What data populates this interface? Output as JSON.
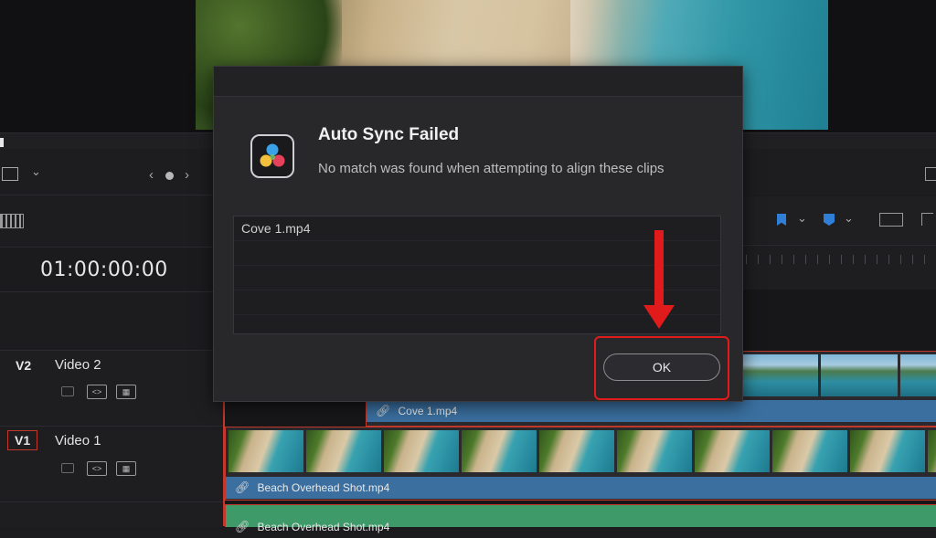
{
  "viewer": {
    "image": "beach-aerial-frame"
  },
  "left_panel": {
    "timecode": "01:00:00:00",
    "tracks": [
      {
        "id": "V2",
        "name": "Video 2"
      },
      {
        "id": "V1",
        "name": "Video 1"
      }
    ]
  },
  "timeline": {
    "clips": [
      {
        "track": "V2",
        "name": "Cove 1.mp4"
      },
      {
        "track": "V1",
        "name": "Beach Overhead Shot.mp4"
      },
      {
        "track": "A1",
        "name": "Beach Overhead Shot.mp4"
      }
    ]
  },
  "dialog": {
    "title": "Auto Sync Failed",
    "message": "No match was found when attempting to align these clips",
    "list_items": [
      "Cove 1.mp4"
    ],
    "ok_label": "OK"
  },
  "annotation": {
    "color": "#e11b1b"
  },
  "colors": {
    "playhead": "#c8362c",
    "video_clip_bar": "#3a6f9f",
    "audio_clip_bar": "#3f9a6a",
    "flag_blue": "#2f7fd6"
  }
}
